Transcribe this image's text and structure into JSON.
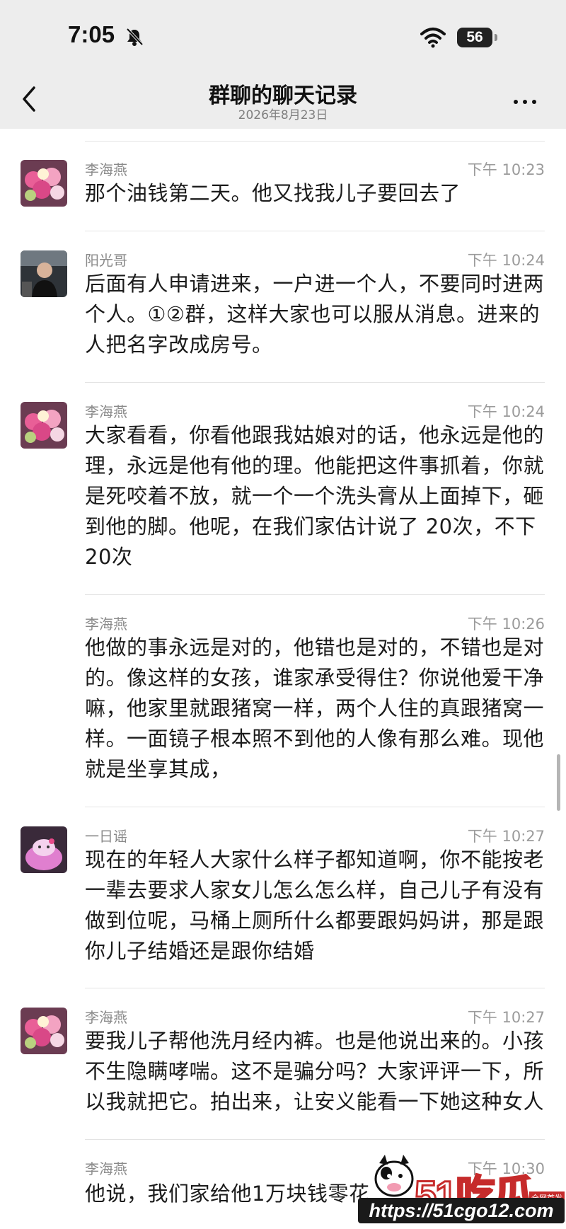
{
  "status_bar": {
    "time": "7:05",
    "battery": "56"
  },
  "nav": {
    "title": "群聊的聊天记录",
    "subtitle": "2026年8月23日"
  },
  "messages": [
    {
      "sender": "李海燕",
      "time": "下午 10:23",
      "text": "那个油钱第二天。他又找我儿子要回去了"
    },
    {
      "sender": "阳光哥",
      "time": "下午 10:24",
      "text": "后面有人申请进来，一户进一个人，不要同时进两个人。①②群，这样大家也可以服从消息。进来的人把名字改成房号。"
    },
    {
      "sender": "李海燕",
      "time": "下午 10:24",
      "text": "大家看看，你看他跟我姑娘对的话，他永远是他的理，永远是他有他的理。他能把这件事抓着，你就是死咬着不放，就一个一个洗头膏从上面掉下，砸到他的脚。他呢，在我们家估计说了 20次，不下20次"
    },
    {
      "sender": "李海燕",
      "time": "下午 10:26",
      "text": "他做的事永远是对的，他错也是对的，不错也是对的。像这样的女孩，谁家承受得住？你说他爱干净嘛，他家里就跟猪窝一样，两个人住的真跟猪窝一样。一面镜子根本照不到他的人像有那么难。现他就是坐享其成，"
    },
    {
      "sender": "一日谣",
      "time": "下午 10:27",
      "text": "现在的年轻人大家什么样子都知道啊，你不能按老一辈去要求人家女儿怎么怎么样，自己儿子有没有做到位呢，马桶上厕所什么都要跟妈妈讲，那是跟你儿子结婚还是跟你结婚"
    },
    {
      "sender": "李海燕",
      "time": "下午 10:27",
      "text": "要我儿子帮他洗月经内裤。也是他说出来的。小孩不生隐瞒哮喘。这不是骗分吗？大家评评一下，所以我就把它。拍出来，让安义能看一下她这种女人"
    },
    {
      "sender": "李海燕",
      "time": "下午 10:30",
      "text": "他说，我们家给他1万块钱零花"
    }
  ],
  "watermark": {
    "brand": "51吃瓜",
    "tag": "全网首发",
    "url": "https://51cgo12.com"
  },
  "colors": {
    "header_bg": "#ededed",
    "divider": "#e3e3e3",
    "watermark_red": "#c62b2b"
  }
}
